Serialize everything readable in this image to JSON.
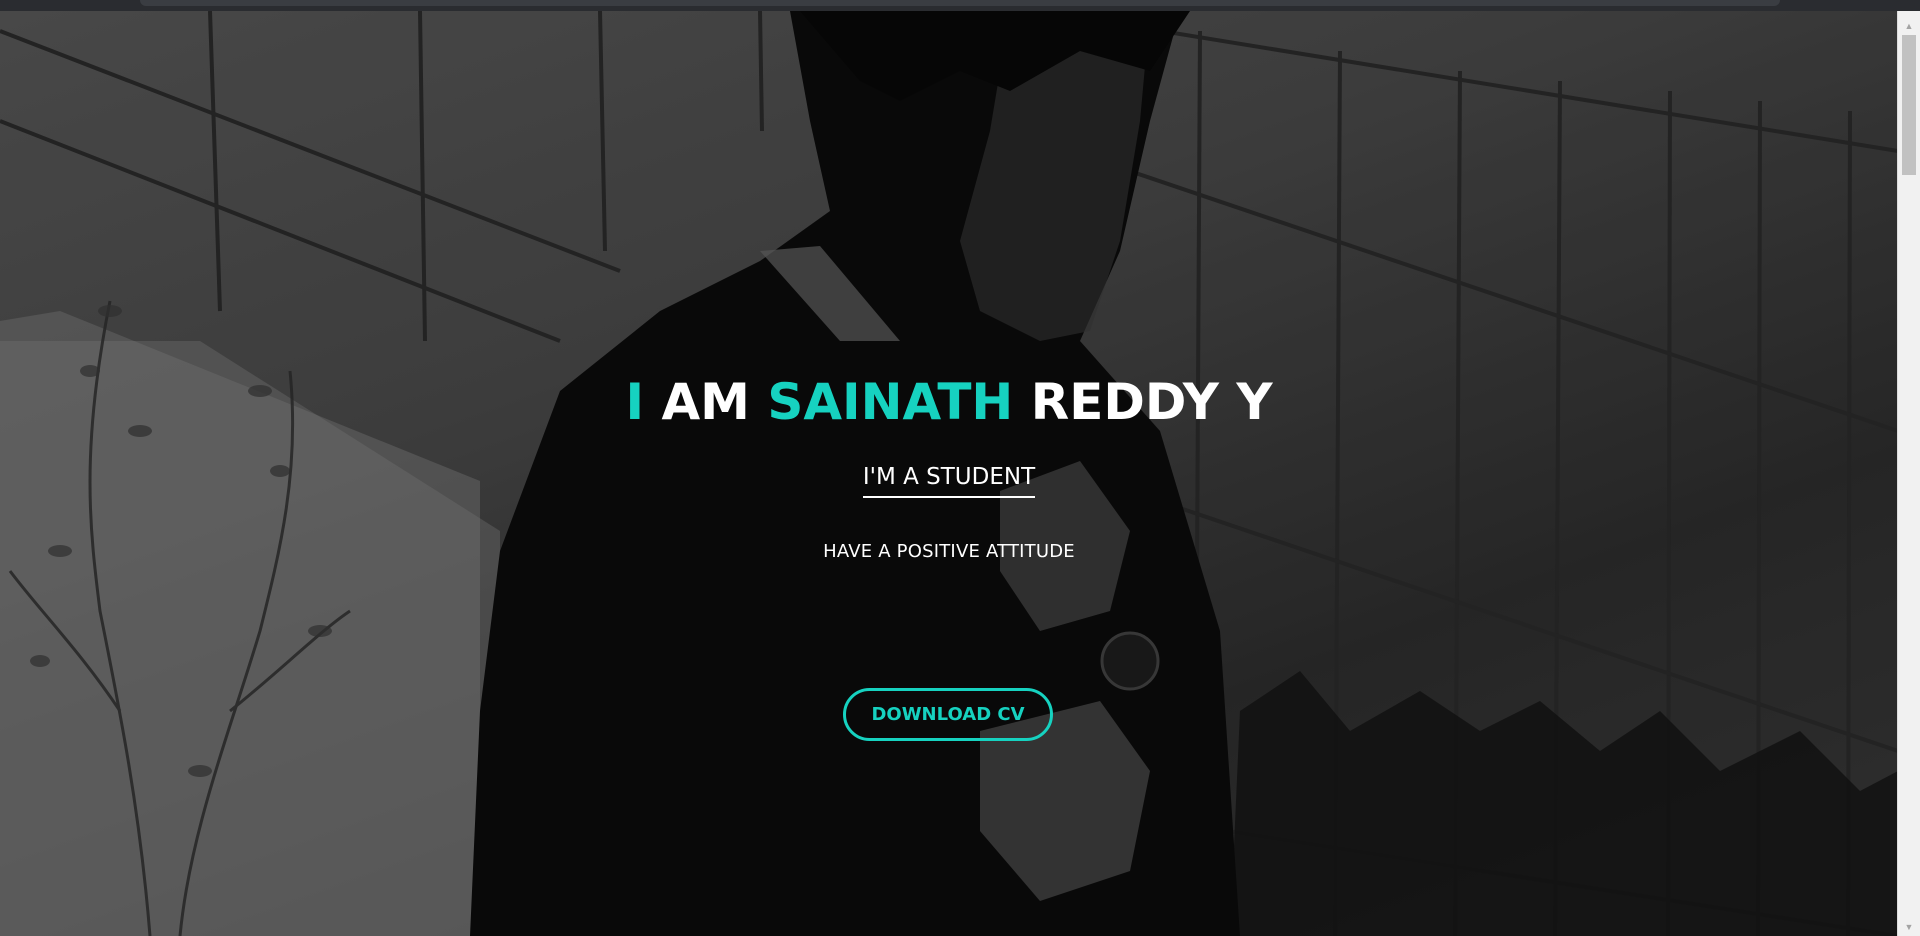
{
  "hero": {
    "title_part1": "I",
    "title_part2": " AM ",
    "title_part3": "SAINATH",
    "title_part4": " REDDY Y",
    "subtitle": "I'M A STUDENT",
    "tagline": "HAVE A POSITIVE ATTITUDE",
    "cta_label": "DOWNLOAD CV",
    "background_image": "grayscale photo of a man in a dark shirt in front of a glass building"
  },
  "colors": {
    "accent": "#16d2c0",
    "text": "#ffffff",
    "overlay": "#2e2e2e"
  },
  "icons": {
    "scroll_up": "chevron-up-icon",
    "scroll_down": "chevron-down-icon"
  }
}
